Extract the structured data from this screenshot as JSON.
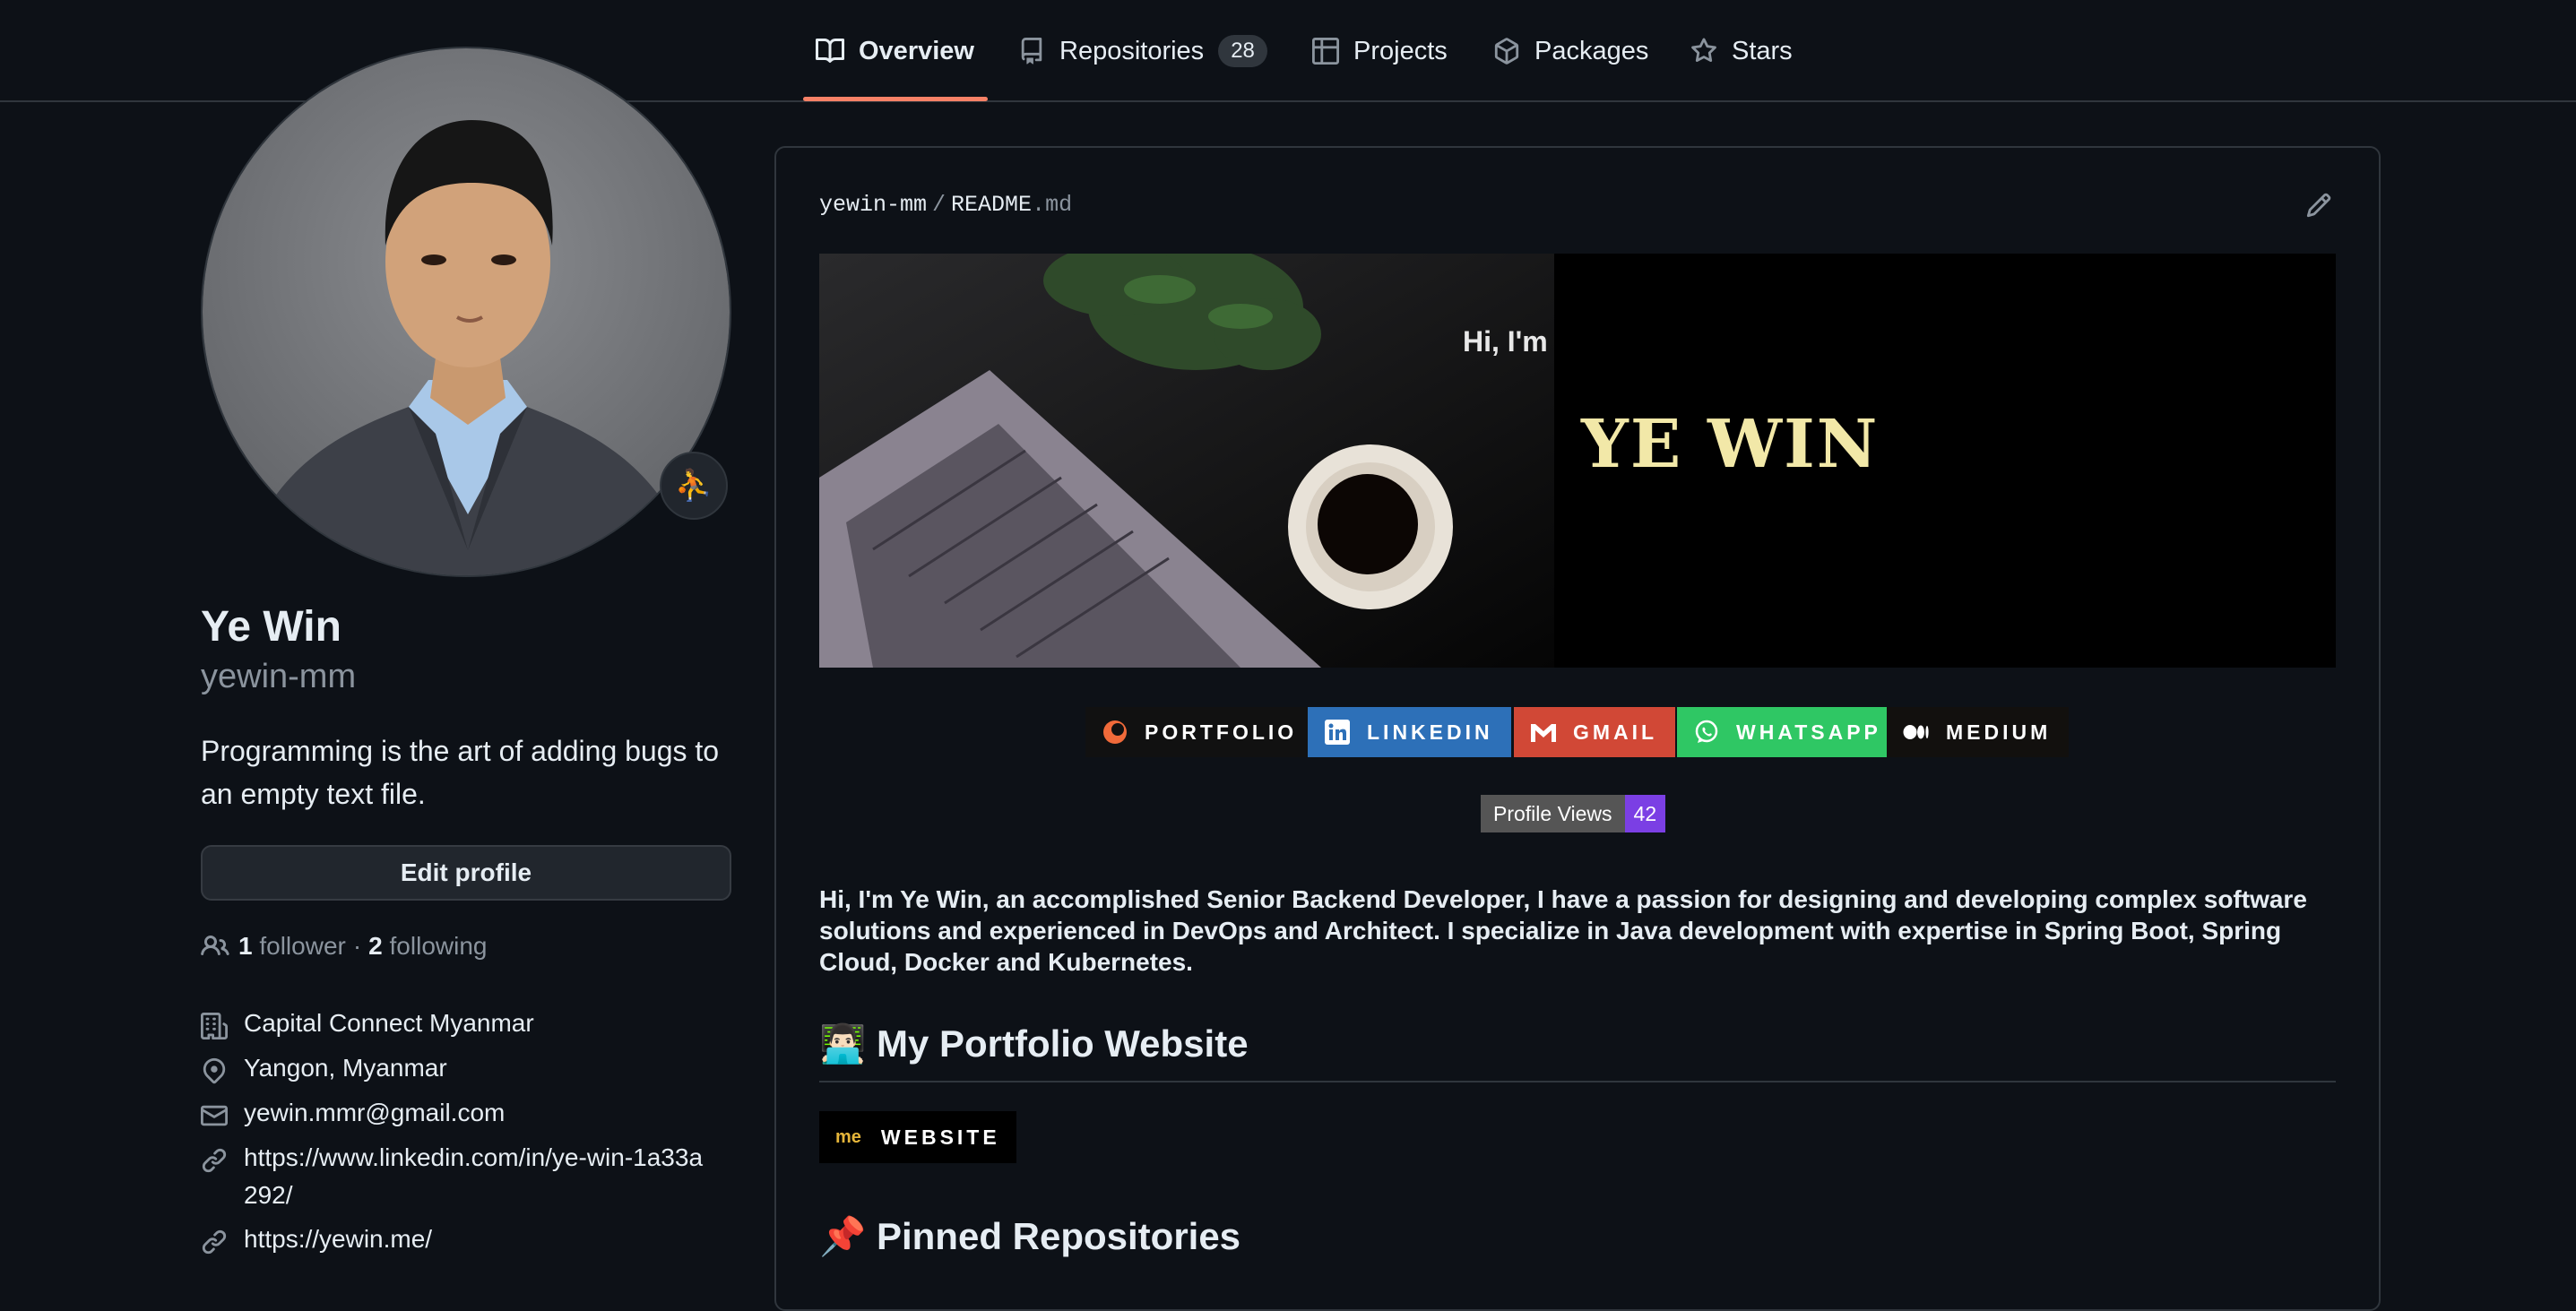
{
  "nav": {
    "tabs": [
      {
        "label": "Overview",
        "icon": "book-icon",
        "active": true
      },
      {
        "label": "Repositories",
        "icon": "repo-icon",
        "count": "28"
      },
      {
        "label": "Projects",
        "icon": "table-icon"
      },
      {
        "label": "Packages",
        "icon": "package-icon"
      },
      {
        "label": "Stars",
        "icon": "star-icon"
      }
    ]
  },
  "profile": {
    "name": "Ye Win",
    "login": "yewin-mm",
    "bio": "Programming is the art of adding bugs to an empty text file.",
    "edit_label": "Edit profile",
    "followers_count": "1",
    "followers_label": "follower",
    "separator": "·",
    "following_count": "2",
    "following_label": "following",
    "company": "Capital Connect Myanmar",
    "location": "Yangon, Myanmar",
    "email": "yewin.mmr@gmail.com",
    "linkedin": "https://www.linkedin.com/in/ye-win-1a33a292/",
    "website": "https://yewin.me/"
  },
  "readme": {
    "owner": "yewin-mm",
    "slash": "/",
    "file_base": "README",
    "file_ext": ".md",
    "banner": {
      "greeting": "Hi, I'm",
      "title": "YE WIN"
    },
    "badges": [
      {
        "label": "PORTFOLIO",
        "color": "#111111",
        "icon": "portfolio-icon"
      },
      {
        "label": "LINKEDIN",
        "color": "#0a66c2",
        "icon": "linkedin-icon"
      },
      {
        "label": "GMAIL",
        "color": "#d14836",
        "icon": "gmail-icon"
      },
      {
        "label": "WHATSAPP",
        "color": "#25d366",
        "icon": "whatsapp-icon"
      },
      {
        "label": "MEDIUM",
        "color": "#12100e",
        "icon": "medium-icon"
      }
    ],
    "profile_views_label": "Profile Views",
    "profile_views_count": "42",
    "intro": "Hi, I'm Ye Win, an accomplished Senior Backend Developer, I have a passion for designing and developing complex software solutions and experienced in DevOps and Architect. I specialize in Java development with expertise in Spring Boot, Spring Cloud, Docker and Kubernetes.",
    "section_portfolio": {
      "emoji": "👨🏻‍💻",
      "title": "My Portfolio Website"
    },
    "website_badge": {
      "prefix": "me",
      "label": "WEBSITE"
    },
    "section_pinned": {
      "emoji": "📌",
      "title": "Pinned Repositories"
    }
  },
  "colors": {
    "accent_underline": "#f78166",
    "background": "#0d1117",
    "border": "#30363d"
  }
}
